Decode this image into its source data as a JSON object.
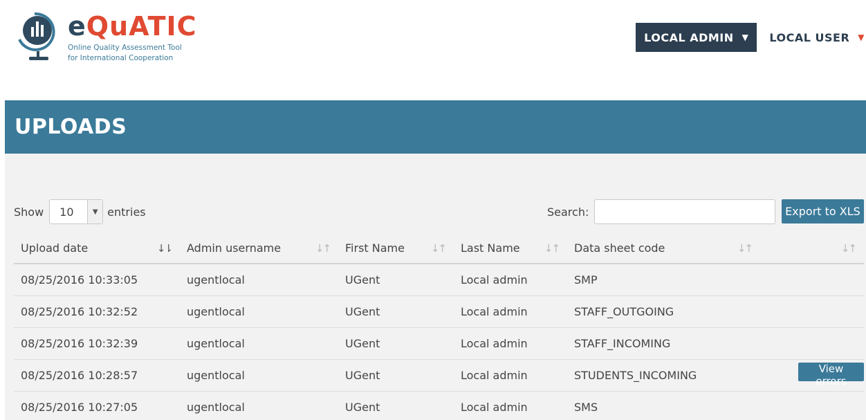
{
  "brand": {
    "name_first": "e",
    "name_rest": "QuATIC",
    "tagline_line1": "Online Quality Assessment Tool",
    "tagline_line2": "for International Cooperation",
    "colors": {
      "navy": "#2f4a5e",
      "red": "#e04a32",
      "teal": "#3b7a99"
    }
  },
  "user_menu": {
    "admin_label": "LOCAL ADMIN",
    "user_label": "LOCAL USER",
    "caret": "▼"
  },
  "page": {
    "title": "UPLOADS"
  },
  "controls": {
    "show_label": "Show",
    "entries_value": "10",
    "entries_label": "entries",
    "search_label": "Search:",
    "search_value": "",
    "export_label": "Export to XLS"
  },
  "table": {
    "columns": [
      "Upload date",
      "Admin username",
      "First Name",
      "Last Name",
      "Data sheet code",
      ""
    ],
    "rows": [
      {
        "date": "08/25/2016 10:33:05",
        "admin": "ugentlocal",
        "first": "UGent",
        "last": "Local admin",
        "code": "SMP",
        "action": ""
      },
      {
        "date": "08/25/2016 10:32:52",
        "admin": "ugentlocal",
        "first": "UGent",
        "last": "Local admin",
        "code": "STAFF_OUTGOING",
        "action": ""
      },
      {
        "date": "08/25/2016 10:32:39",
        "admin": "ugentlocal",
        "first": "UGent",
        "last": "Local admin",
        "code": "STAFF_INCOMING",
        "action": ""
      },
      {
        "date": "08/25/2016 10:28:57",
        "admin": "ugentlocal",
        "first": "UGent",
        "last": "Local admin",
        "code": "STUDENTS_INCOMING",
        "action": "View errors"
      },
      {
        "date": "08/25/2016 10:27:05",
        "admin": "ugentlocal",
        "first": "UGent",
        "last": "Local admin",
        "code": "SMS",
        "action": ""
      }
    ]
  },
  "icons": {
    "logo": "globe-bar-chart-icon",
    "sort_active": "sort-descending-icon",
    "sort": "sort-both-icon",
    "select_arrow": "chevron-down-icon"
  }
}
